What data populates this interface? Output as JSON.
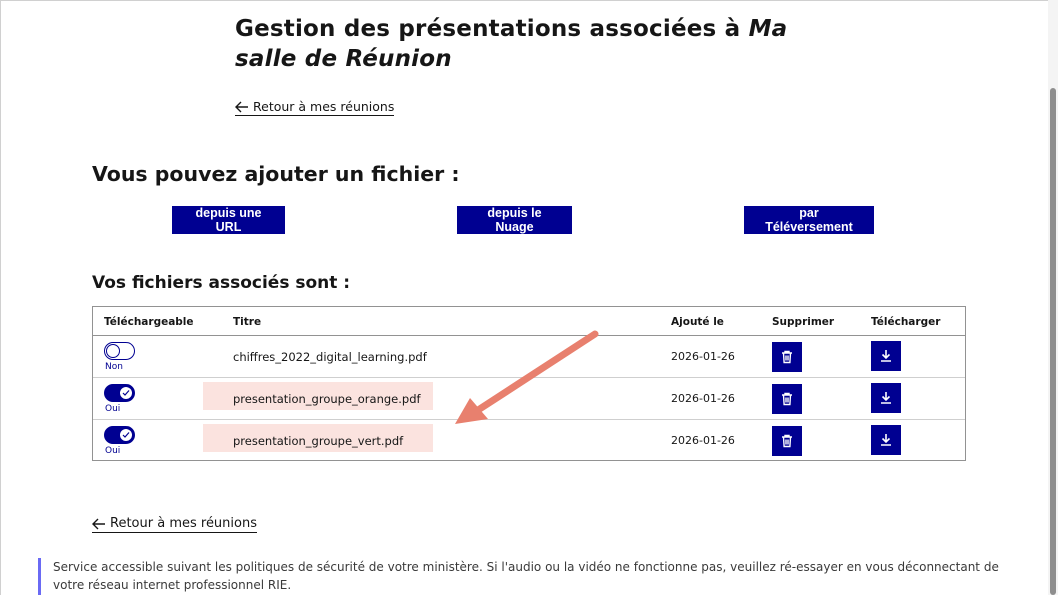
{
  "header": {
    "title_prefix": "Gestion des présentations associées à ",
    "title_room": "Ma salle de Réunion",
    "back_link": "Retour à mes réunions"
  },
  "add_section": {
    "title": "Vous pouvez ajouter un fichier :",
    "buttons": {
      "url": "depuis une URL",
      "cloud": "depuis le Nuage",
      "upload": "par Téléversement"
    }
  },
  "files_section": {
    "title": "Vos fichiers associés sont :",
    "columns": [
      "Téléchargeable",
      "Titre",
      "Ajouté le",
      "Supprimer",
      "Télécharger"
    ],
    "rows": [
      {
        "downloadable": false,
        "downloadable_label": "Non",
        "title": "chiffres_2022_digital_learning.pdf",
        "date": "2026-01-26",
        "highlighted": false
      },
      {
        "downloadable": true,
        "downloadable_label": "Oui",
        "title": "presentation_groupe_orange.pdf",
        "date": "2026-01-26",
        "highlighted": true
      },
      {
        "downloadable": true,
        "downloadable_label": "Oui",
        "title": "presentation_groupe_vert.pdf",
        "date": "2026-01-26",
        "highlighted": true
      }
    ]
  },
  "footer": {
    "back_link": "Retour à mes réunions",
    "notice": "Service accessible suivant les politiques de sécurité de votre ministère. Si l'audio ou la vidéo ne fonctionne pas, veuillez ré-essayer en vous déconnectant de votre réseau internet professionnel RIE."
  },
  "colors": {
    "primary": "#000091",
    "highlight": "#fbe3df",
    "arrow": "#e8806e"
  },
  "icons": {
    "back": "arrow-left-icon",
    "delete": "trash-icon",
    "download": "download-icon",
    "check": "check-icon"
  }
}
